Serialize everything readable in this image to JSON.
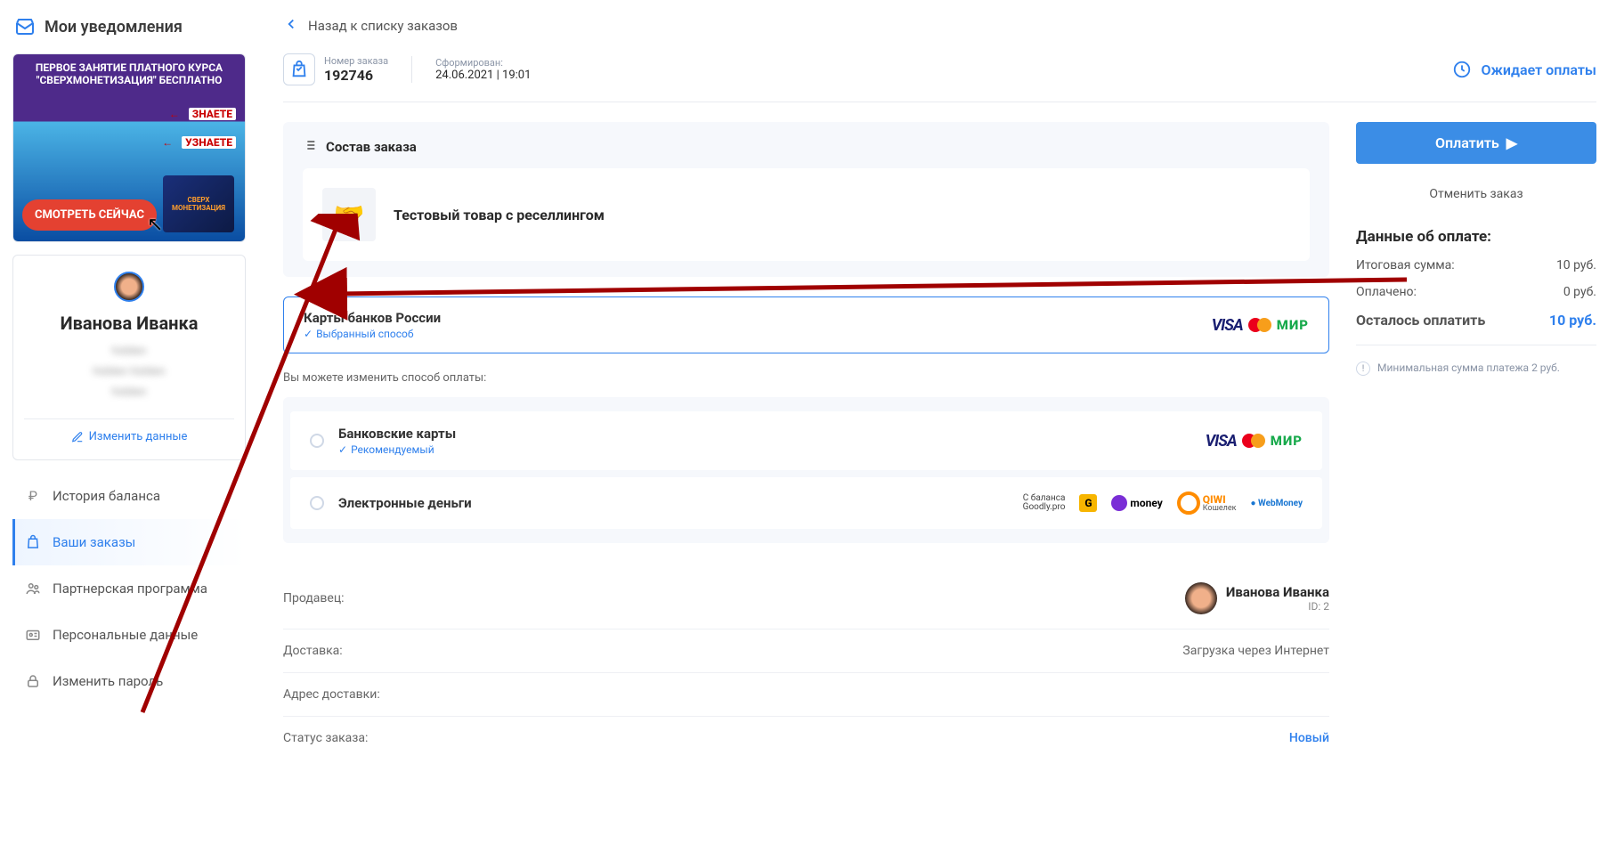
{
  "sidebar": {
    "notifications_title": "Мои уведомления",
    "promo": {
      "line1": "ПЕРВОЕ ЗАНЯТИЕ ПЛАТНОГО КУРСА",
      "line2": "\"СВЕРХМОНЕТИЗАЦИЯ\" БЕСПЛАТНО",
      "know": "ЗНАЕТЕ",
      "learn": "УЗНАЕТЕ",
      "cta": "СМОТРЕТЬ СЕЙЧАС"
    },
    "profile": {
      "name": "Иванова Иванка",
      "edit": "Изменить данные"
    },
    "menu": [
      {
        "label": "История баланса",
        "icon": "ruble-icon",
        "active": false
      },
      {
        "label": "Ваши заказы",
        "icon": "bag-icon",
        "active": true
      },
      {
        "label": "Партнерская программа",
        "icon": "people-icon",
        "active": false
      },
      {
        "label": "Персональные данные",
        "icon": "id-icon",
        "active": false
      },
      {
        "label": "Изменить пароль",
        "icon": "lock-icon",
        "active": false
      }
    ]
  },
  "main": {
    "back": "Назад к списку заказов",
    "order_num_label": "Номер заказа",
    "order_num": "192746",
    "formed_label": "Сформирован:",
    "formed_value": "24.06.2021 | 19:01",
    "status": "Ожидает оплаты",
    "composition_title": "Состав заказа",
    "product_name": "Тестовый товар с реселлингом",
    "selected_method": {
      "title": "Карты банков России",
      "badge": "Выбранный способ"
    },
    "change_hint": "Вы можете изменить способ оплаты:",
    "alt_methods": [
      {
        "title": "Банковские карты",
        "rec": "Рекомендуемый",
        "kind": "cards"
      },
      {
        "title": "Электронные деньги",
        "rec": "",
        "kind": "emoney"
      }
    ],
    "details": {
      "seller_label": "Продавец:",
      "seller_name": "Иванова Иванка",
      "seller_id": "ID: 2",
      "delivery_label": "Доставка:",
      "delivery_value": "Загрузка через Интернет",
      "address_label": "Адрес доставки:",
      "address_value": "",
      "status_label": "Статус заказа:",
      "status_value": "Новый"
    },
    "right": {
      "pay_btn": "Оплатить",
      "cancel": "Отменить заказ",
      "summary_title": "Данные об оплате:",
      "total_label": "Итоговая сумма:",
      "total_value": "10 руб.",
      "paid_label": "Оплачено:",
      "paid_value": "0 руб.",
      "remain_label": "Осталось оплатить",
      "remain_value": "10 руб.",
      "min_note": "Минимальная сумма платежа 2 руб."
    },
    "emoney": {
      "goodly1": "С баланса",
      "goodly2": "Goodly.pro",
      "g": "G",
      "ym": "money",
      "qiwi": "QIWI",
      "qiwi2": "Кошелек",
      "wm": "WebMoney"
    }
  }
}
